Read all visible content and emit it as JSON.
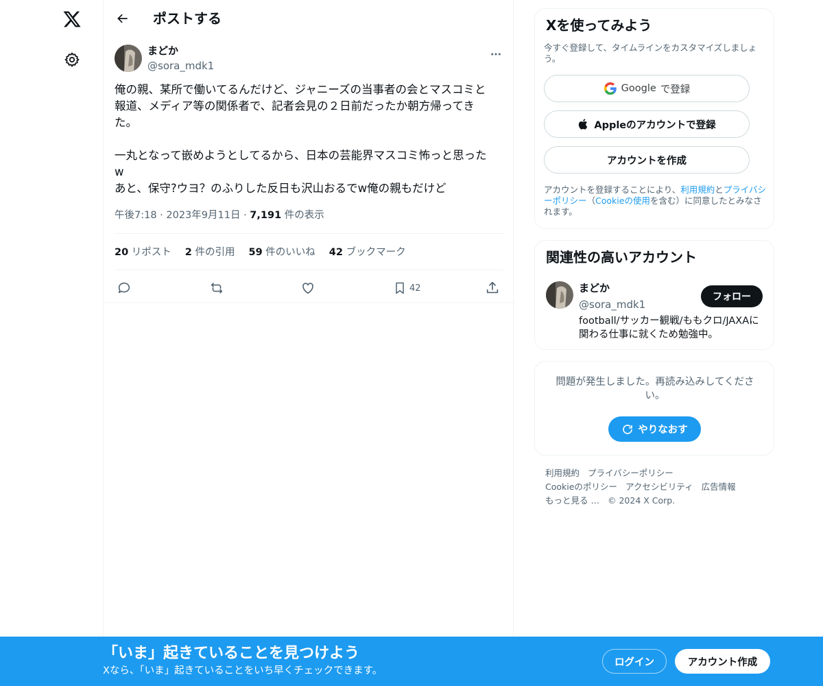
{
  "nav": {
    "logo_icon": "x-logo-icon",
    "settings_icon": "gear-icon"
  },
  "header": {
    "title": "ポストする"
  },
  "post": {
    "author_name": "まどか",
    "author_handle": "@sora_mdk1",
    "text": "俺の親、某所で働いてるんだけど、ジャニーズの当事者の会とマスコミと\n報道、メディア等の関係者で、記者会見の２日前だったか朝方帰ってき\nた。\n\n一丸となって嵌めようとしてるから、日本の芸能界マスコミ怖っと思った\nw\nあと、保守?ウヨ？のふりした反日も沢山おるでw俺の親もだけど",
    "time": "午後7:18",
    "date": "2023年9月11日",
    "dot": "·",
    "views_count": "7,191",
    "views_label": "件の表示",
    "stats": [
      {
        "count": "20",
        "label": "リポスト"
      },
      {
        "count": "2",
        "label": "件の引用"
      },
      {
        "count": "59",
        "label": "件のいいね"
      },
      {
        "count": "42",
        "label": "ブックマーク"
      }
    ],
    "bookmark_count": "42"
  },
  "signup": {
    "title": "Xを使ってみよう",
    "subtitle": "今すぐ登録して、タイムラインをカスタマイズしましょう。",
    "google_brand": "Google",
    "google_suffix": "で登録",
    "apple_label": "Appleのアカウントで登録",
    "create_label": "アカウントを作成",
    "legal_1": "アカウントを登録することにより、",
    "legal_terms": "利用規約",
    "legal_and": "と",
    "legal_privacy": "プライバシーポリシー",
    "legal_2": "（",
    "legal_cookie": "Cookieの使用",
    "legal_3": "を含む）に同意したとみなされます。"
  },
  "related": {
    "title": "関連性の高いアカウント",
    "name": "まどか",
    "handle": "@sora_mdk1",
    "follow_label": "フォロー",
    "bio": "football/サッカー観戦/ももクロ/JAXAに関わる仕事に就くため勉強中。"
  },
  "error": {
    "message": "問題が発生しました。再読み込みしてください。",
    "retry_label": "やりなおす"
  },
  "footer": {
    "terms": "利用規約",
    "privacy": "プライバシーポリシー",
    "cookie": "Cookieのポリシー",
    "accessibility": "アクセシビリティ",
    "ads": "広告情報",
    "more": "もっと見る …",
    "copyright": "© 2024 X Corp."
  },
  "banner": {
    "headline": "「いま」起きていることを見つけよう",
    "subline": "Xなら、「いま」起きていることをいち早くチェックできます。",
    "login_label": "ログイン",
    "create_label": "アカウント作成"
  },
  "colors": {
    "accent": "#1d9bf0",
    "text": "#0f1419",
    "muted": "#536471",
    "border": "#eff3f4"
  }
}
